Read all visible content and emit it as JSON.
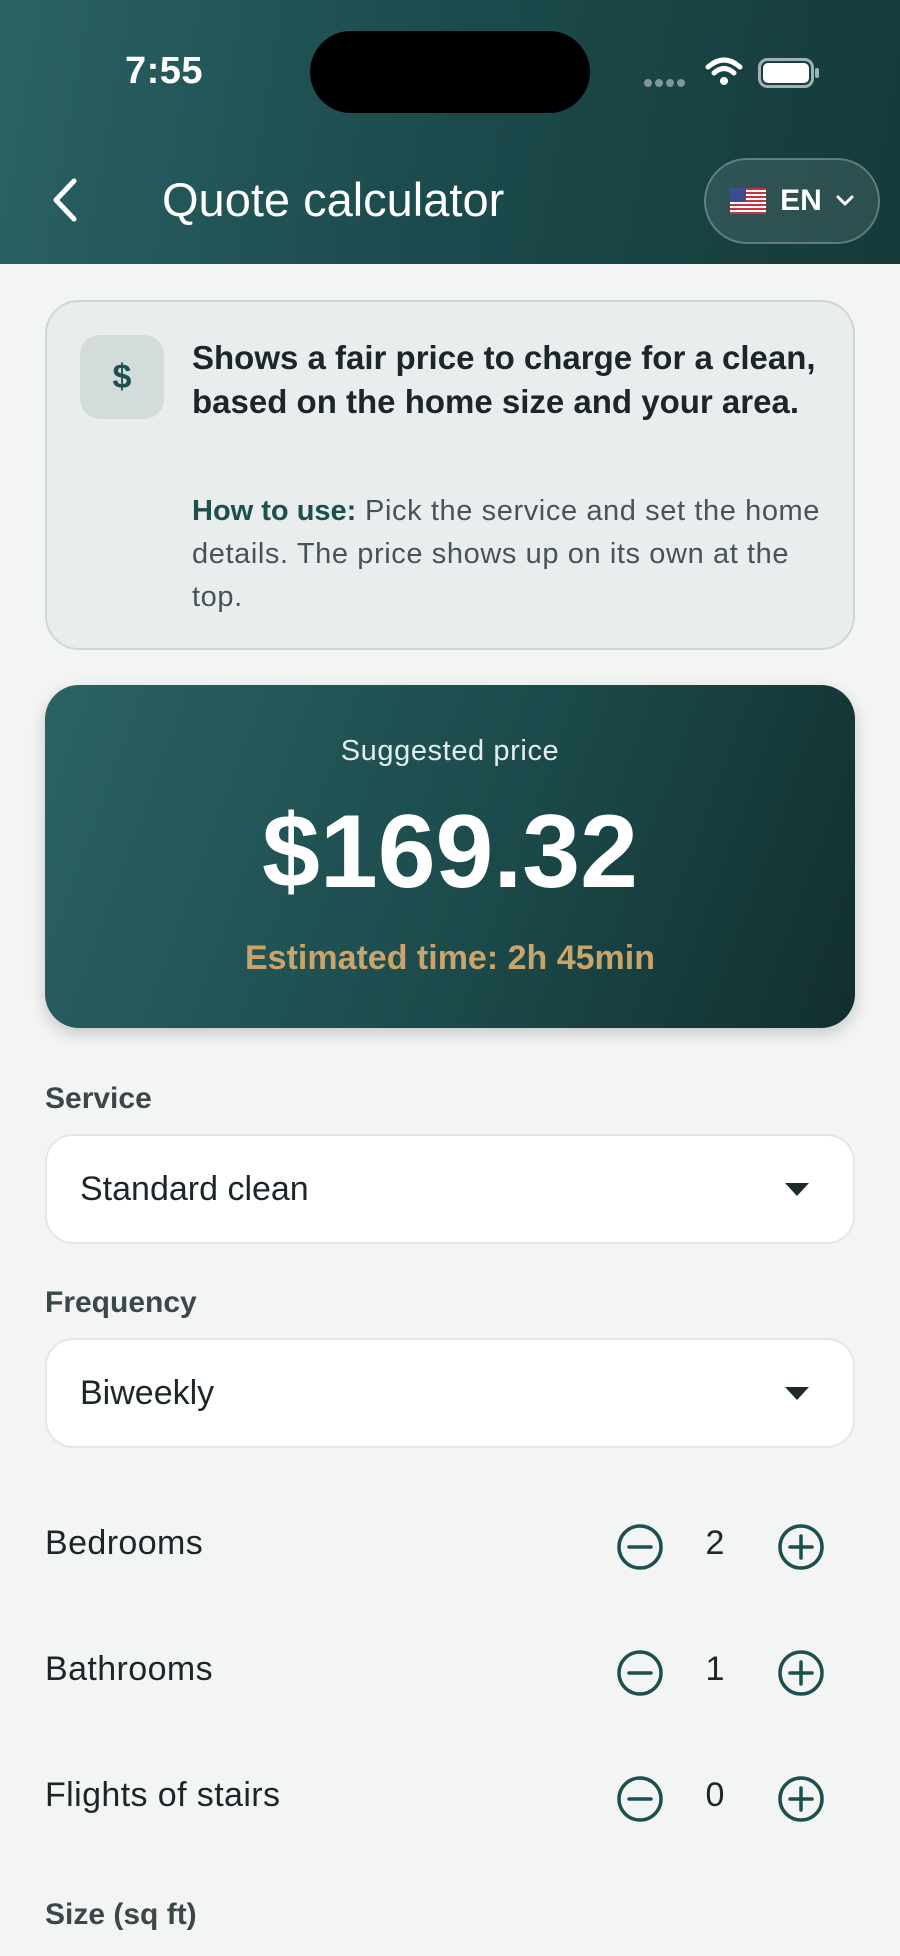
{
  "status_bar": {
    "time": "7:55"
  },
  "header": {
    "title": "Quote calculator",
    "back_icon": "chevron-left-icon",
    "language": {
      "label": "EN",
      "flag": "us-flag-icon",
      "chevron": "chevron-down-icon"
    }
  },
  "info": {
    "icon": "dollar-icon",
    "description": "Shows a fair price to charge for a clean, based on the home size and your area.",
    "howto_label": "How to use:",
    "howto_text": " Pick the service and set the home details. The price shows up on its own at the top."
  },
  "price": {
    "label": "Suggested price",
    "value": "$169.32",
    "estimated_time": "Estimated time: 2h 45min"
  },
  "form": {
    "service_label": "Service",
    "service_value": "Standard clean",
    "frequency_label": "Frequency",
    "frequency_value": "Biweekly",
    "steppers": [
      {
        "label": "Bedrooms",
        "value": "2"
      },
      {
        "label": "Bathrooms",
        "value": "1"
      },
      {
        "label": "Flights of stairs",
        "value": "0"
      }
    ],
    "size_label": "Size (sq ft)"
  },
  "colors": {
    "header_bg": "#1d4c4e",
    "accent_gold": "#c9a46b",
    "teal_text": "#1d4f4f"
  }
}
